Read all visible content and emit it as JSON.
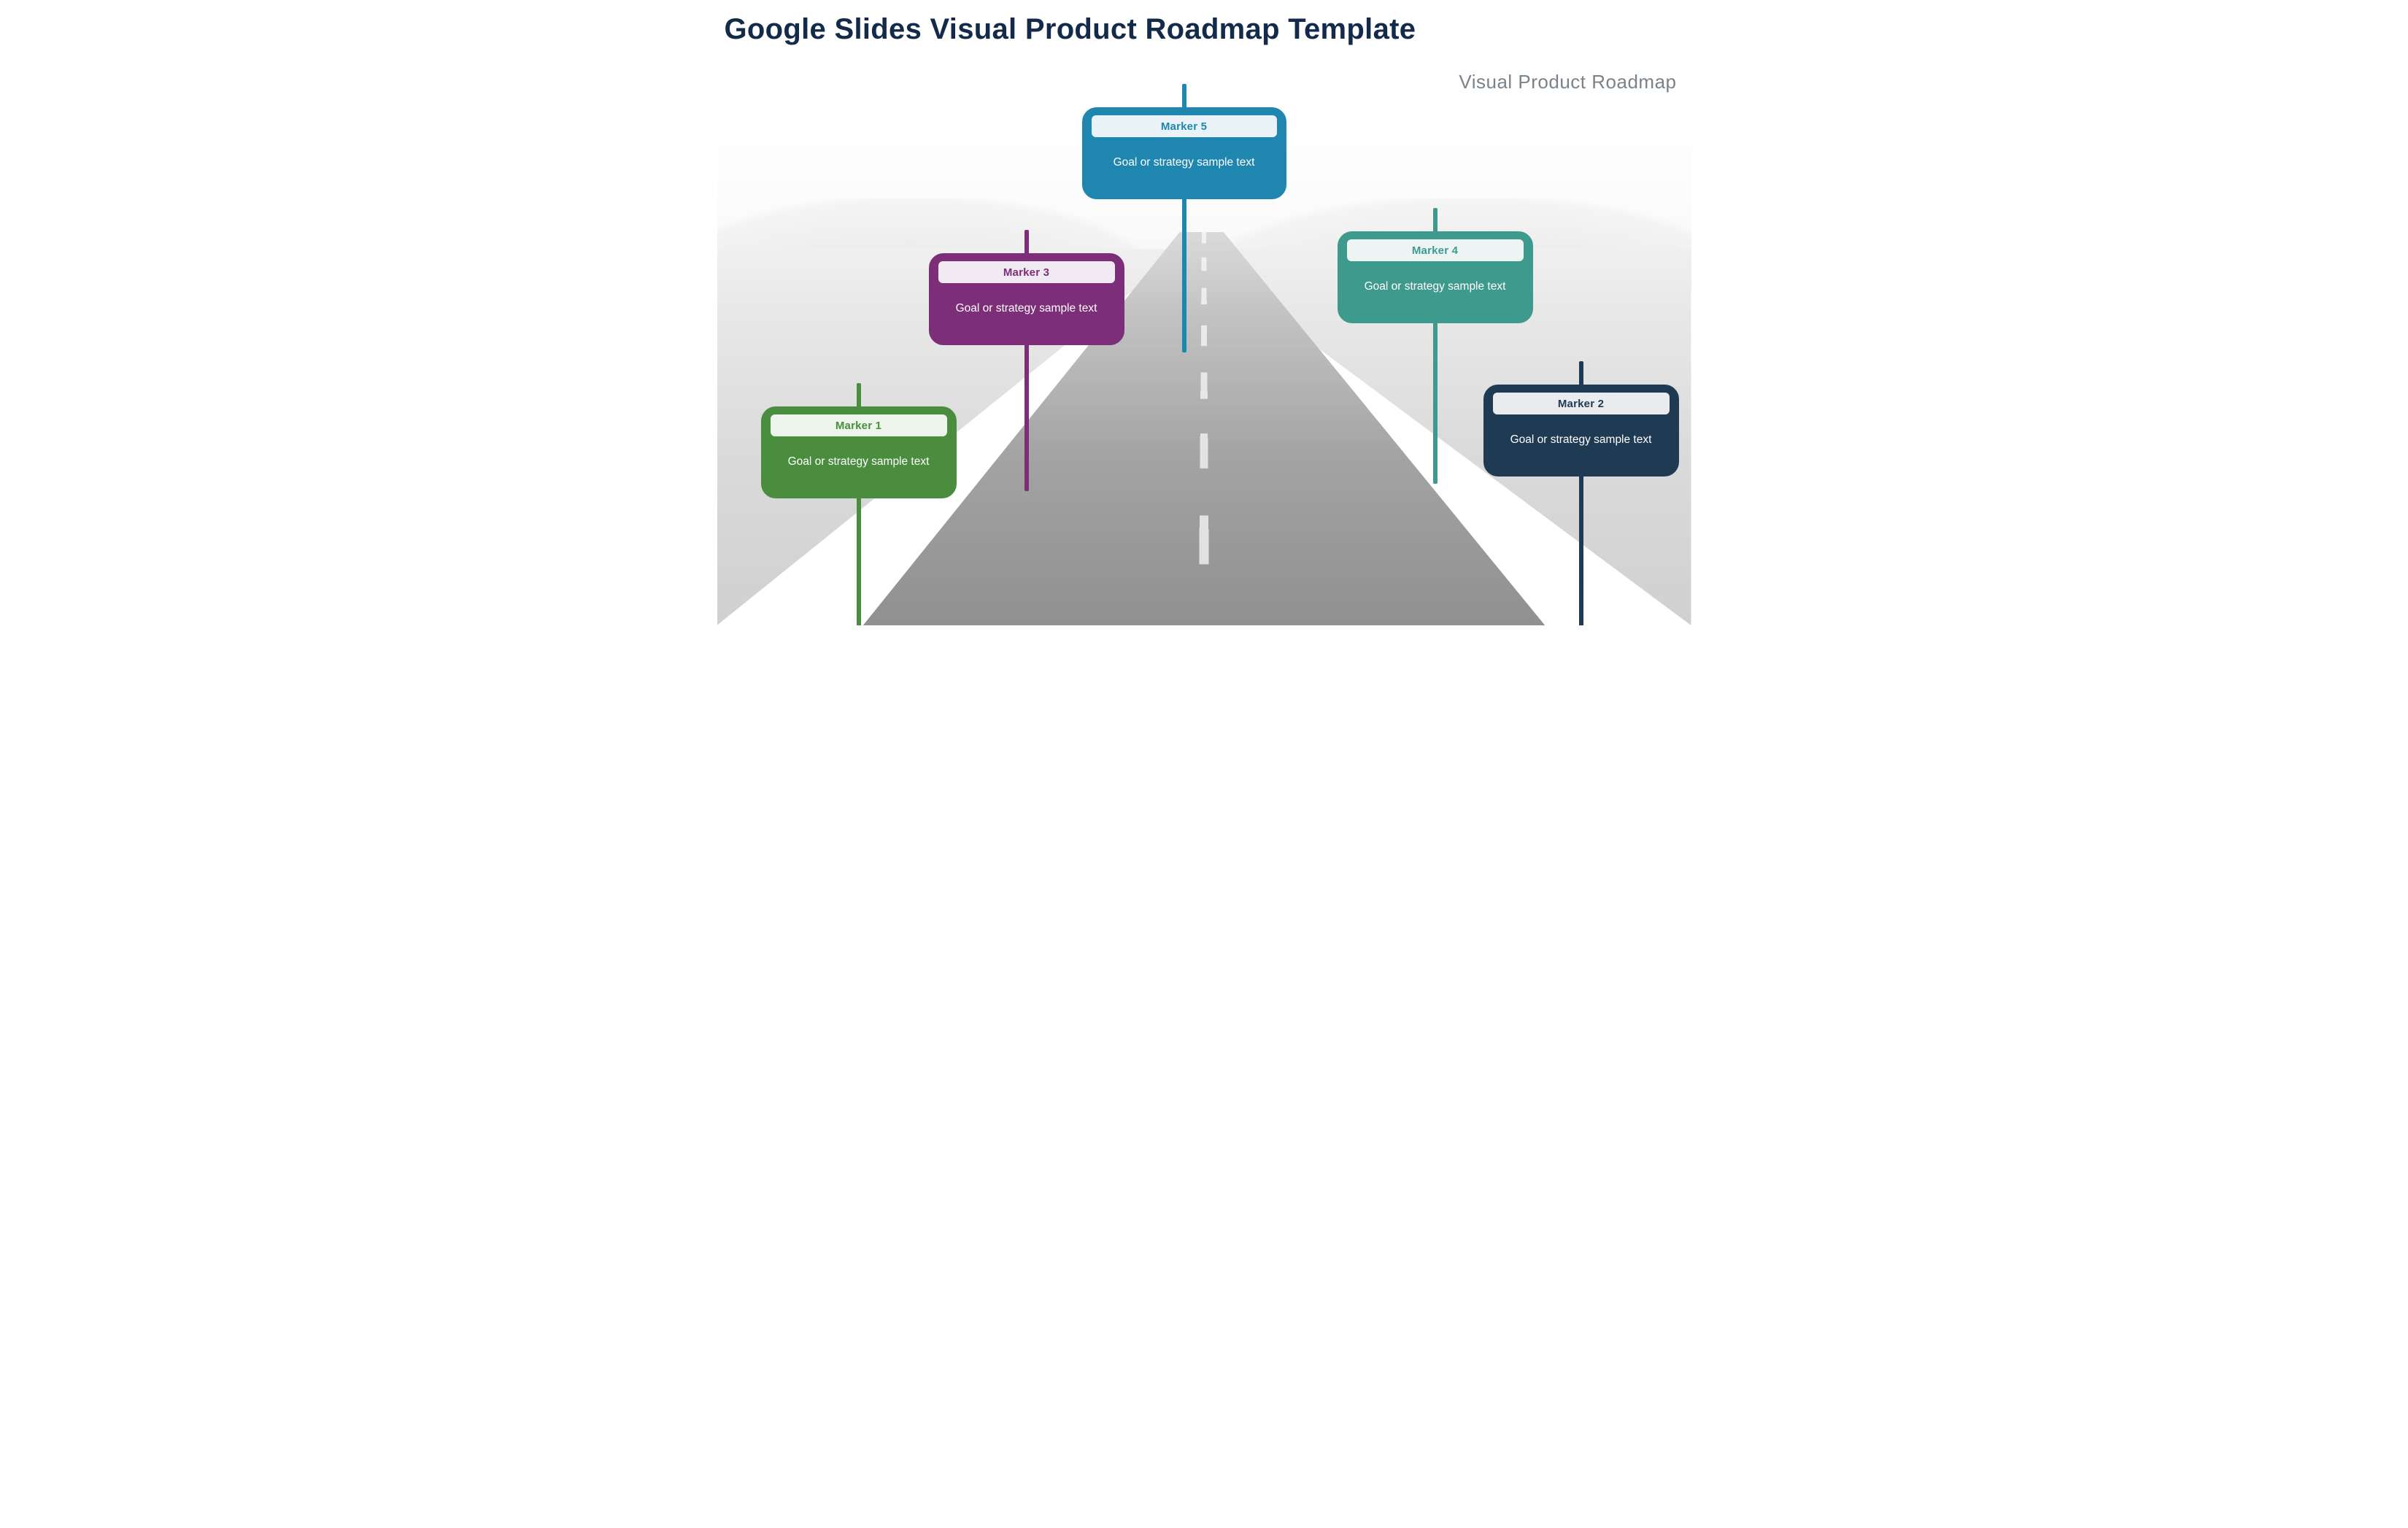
{
  "title": "Google Slides Visual Product Roadmap Template",
  "subtitle": "Visual Product Roadmap",
  "markers": {
    "m1": {
      "label": "Marker 1",
      "body": "Goal or strategy sample text",
      "color": "#4a8d3f"
    },
    "m2": {
      "label": "Marker 2",
      "body": "Goal or strategy sample text",
      "color": "#1f3a53"
    },
    "m3": {
      "label": "Marker 3",
      "body": "Goal or strategy sample text",
      "color": "#7c2e78"
    },
    "m4": {
      "label": "Marker 4",
      "body": "Goal or strategy sample text",
      "color": "#3f9a8e"
    },
    "m5": {
      "label": "Marker 5",
      "body": "Goal or strategy sample text",
      "color": "#1f86af"
    }
  }
}
